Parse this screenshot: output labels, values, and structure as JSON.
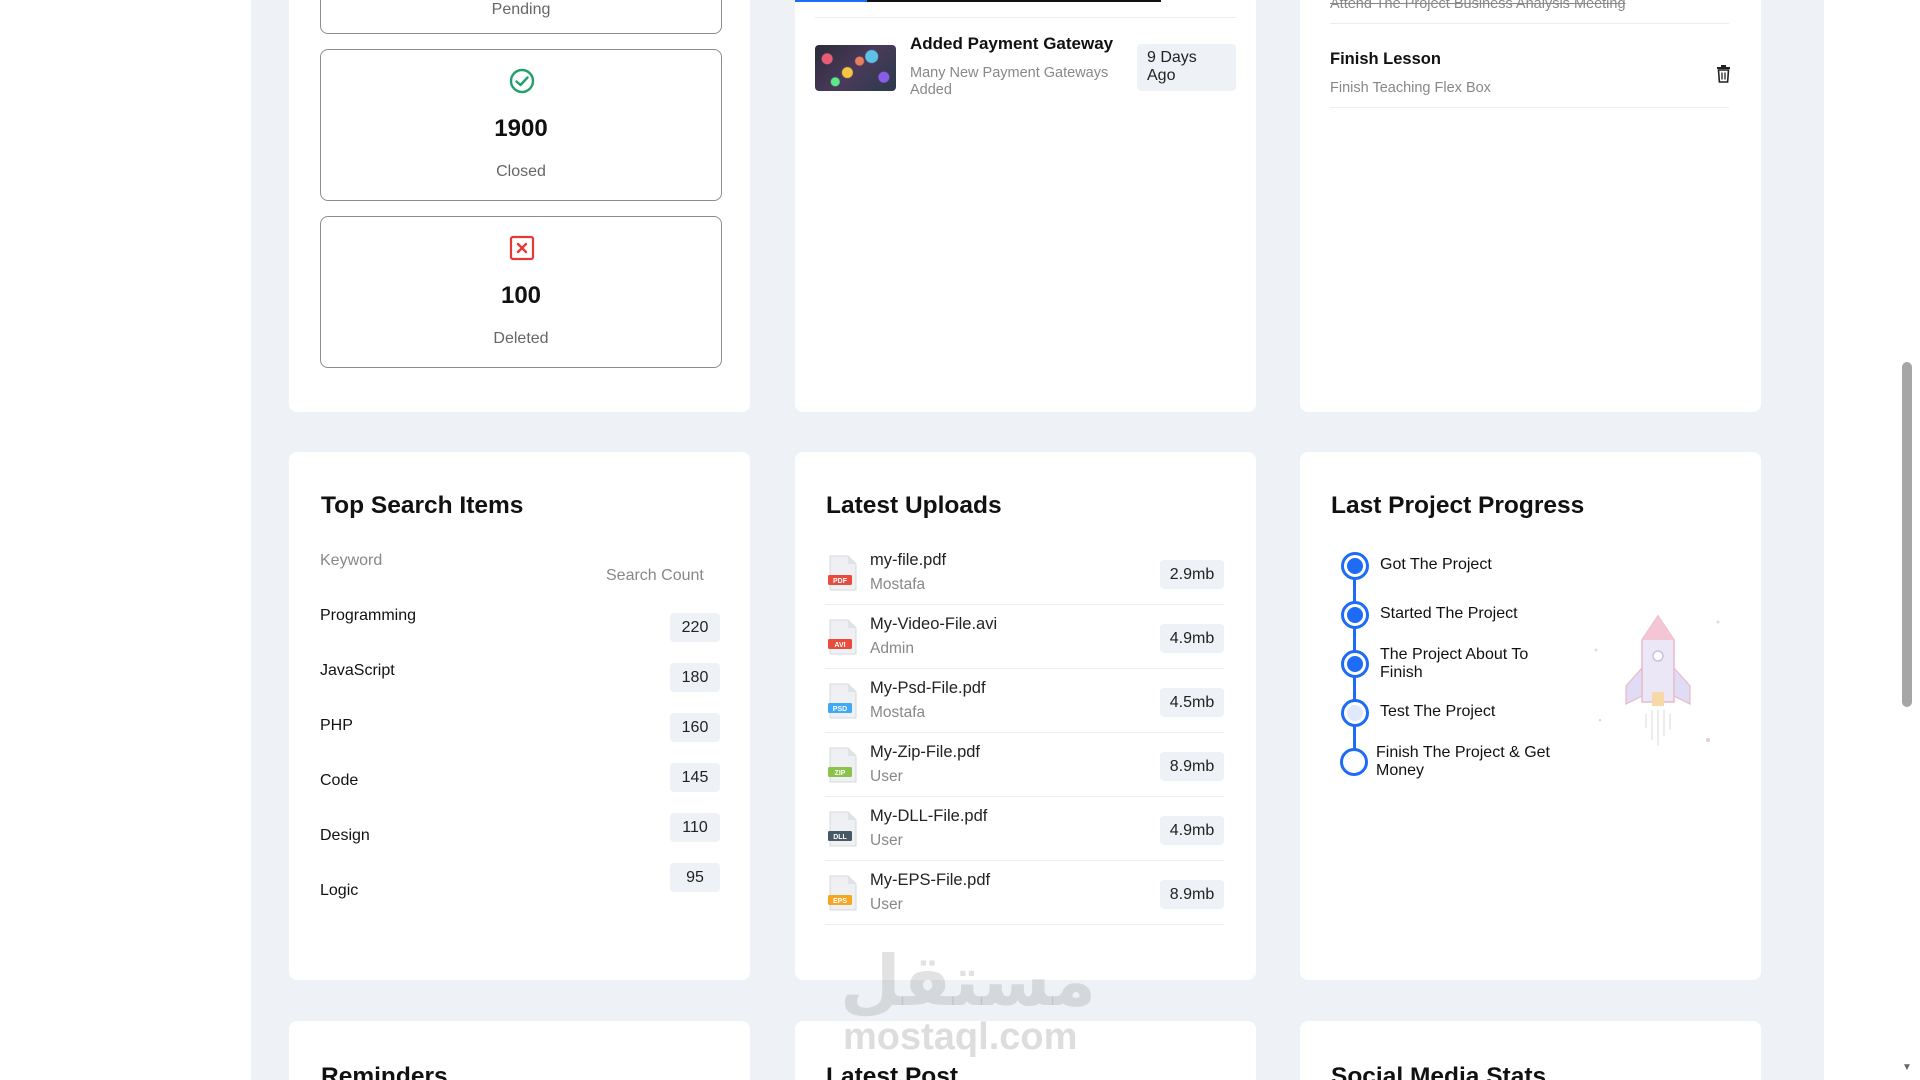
{
  "tickets": {
    "pending_label": "Pending",
    "closed": {
      "value": "1900",
      "label": "Closed"
    },
    "deleted": {
      "value": "100",
      "label": "Deleted"
    }
  },
  "news": {
    "title": "Added Payment Gateway",
    "desc": "Many New Payment Gateways Added",
    "badge": "9 Days Ago"
  },
  "tasks": {
    "done_item": "Attend The Project Business Analysis Meeting",
    "title": "Finish Lesson",
    "desc": "Finish Teaching Flex Box"
  },
  "search": {
    "title": "Top Search Items",
    "keyword_header": "Keyword",
    "count_header": "Search Count",
    "items": [
      {
        "keyword": "Programming",
        "count": "220"
      },
      {
        "keyword": "JavaScript",
        "count": "180"
      },
      {
        "keyword": "PHP",
        "count": "160"
      },
      {
        "keyword": "Code",
        "count": "145"
      },
      {
        "keyword": "Design",
        "count": "110"
      },
      {
        "keyword": "Logic",
        "count": "95"
      }
    ]
  },
  "uploads": {
    "title": "Latest Uploads",
    "items": [
      {
        "name": "my-file.pdf",
        "user": "Mostafa",
        "size": "2.9mb",
        "type": "PDF",
        "color": "#e74c3c"
      },
      {
        "name": "My-Video-File.avi",
        "user": "Admin",
        "size": "4.9mb",
        "type": "AVI",
        "color": "#e74c3c"
      },
      {
        "name": "My-Psd-File.pdf",
        "user": "Mostafa",
        "size": "4.5mb",
        "type": "PSD",
        "color": "#3fa9f5"
      },
      {
        "name": "My-Zip-File.pdf",
        "user": "User",
        "size": "8.9mb",
        "type": "ZIP",
        "color": "#8bc34a"
      },
      {
        "name": "My-DLL-File.pdf",
        "user": "User",
        "size": "4.9mb",
        "type": "DLL",
        "color": "#455a64"
      },
      {
        "name": "My-EPS-File.pdf",
        "user": "User",
        "size": "8.9mb",
        "type": "EPS",
        "color": "#f5a623"
      }
    ]
  },
  "progress": {
    "title": "Last Project Progress",
    "steps": [
      {
        "label": "Got The Project",
        "state": "done"
      },
      {
        "label": "Started The Project",
        "state": "done"
      },
      {
        "label": "The Project About To Finish",
        "state": "done"
      },
      {
        "label": "Test The Project",
        "state": "current"
      },
      {
        "label": "Finish The Project & Get Money",
        "state": "todo"
      }
    ]
  },
  "bottom": {
    "reminders_title": "Reminders",
    "latest_post_title": "Latest Post",
    "social_title": "Social Media Stats"
  },
  "watermark": {
    "arabic": "مستقل",
    "latin": "mostaql.com"
  },
  "colors": {
    "accent": "#1e6bf5",
    "page_bg": "#eef1f5",
    "success": "#22a06b",
    "danger": "#e53935"
  }
}
